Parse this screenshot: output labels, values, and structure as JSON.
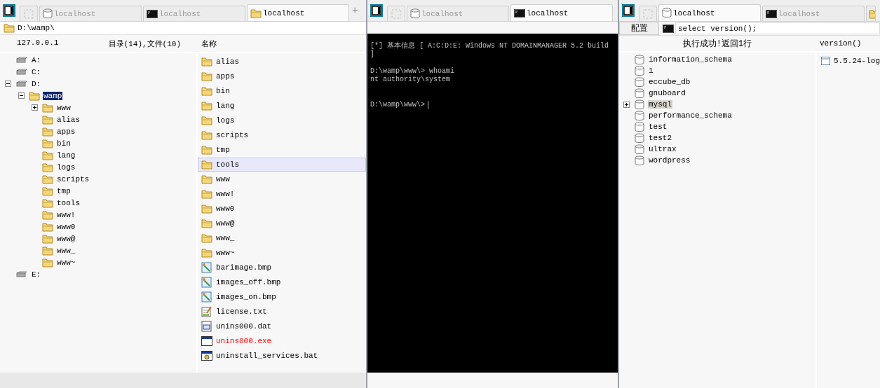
{
  "file_manager": {
    "tabs": [
      {
        "kind": "blank",
        "selected": false
      },
      {
        "kind": "database",
        "label": "localhost",
        "selected": false
      },
      {
        "kind": "terminal",
        "label": "localhost",
        "selected": false
      },
      {
        "kind": "folder",
        "label": "localhost",
        "selected": true
      }
    ],
    "add_tab": "+",
    "path": "D:\\wamp\\",
    "host": "127.0.0.1",
    "summary": "目录(14),文件(10)",
    "name_column": "名称",
    "tree": [
      {
        "kind": "drive",
        "label": "A:",
        "selected": false
      },
      {
        "kind": "drive",
        "label": "C:",
        "selected": false
      },
      {
        "kind": "drive",
        "label": "D:",
        "expanded": true,
        "selected": false,
        "children": [
          {
            "kind": "folder",
            "label": "wamp",
            "expanded": true,
            "selected": true,
            "children": [
              {
                "kind": "folder",
                "label": "www",
                "expanded": false,
                "selected": false
              },
              {
                "kind": "folder",
                "label": "alias",
                "selected": false
              },
              {
                "kind": "folder",
                "label": "apps",
                "selected": false
              },
              {
                "kind": "folder",
                "label": "bin",
                "selected": false
              },
              {
                "kind": "folder",
                "label": "lang",
                "selected": false
              },
              {
                "kind": "folder",
                "label": "logs",
                "selected": false
              },
              {
                "kind": "folder",
                "label": "scripts",
                "selected": false
              },
              {
                "kind": "folder",
                "label": "tmp",
                "selected": false
              },
              {
                "kind": "folder",
                "label": "tools",
                "selected": false
              },
              {
                "kind": "folder",
                "label": "www!",
                "selected": false
              },
              {
                "kind": "folder",
                "label": "www0",
                "selected": false
              },
              {
                "kind": "folder",
                "label": "www@",
                "selected": false
              },
              {
                "kind": "folder",
                "label": "www_",
                "selected": false
              },
              {
                "kind": "folder",
                "label": "www~",
                "selected": false
              }
            ]
          }
        ]
      },
      {
        "kind": "drive",
        "label": "E:",
        "selected": false
      }
    ],
    "files": [
      {
        "kind": "folder",
        "name": "alias",
        "selected": false
      },
      {
        "kind": "folder",
        "name": "apps",
        "selected": false
      },
      {
        "kind": "folder",
        "name": "bin",
        "selected": false
      },
      {
        "kind": "folder",
        "name": "lang",
        "selected": false
      },
      {
        "kind": "folder",
        "name": "logs",
        "selected": false
      },
      {
        "kind": "folder",
        "name": "scripts",
        "selected": false
      },
      {
        "kind": "folder",
        "name": "tmp",
        "selected": false
      },
      {
        "kind": "folder",
        "name": "tools",
        "selected": true
      },
      {
        "kind": "folder",
        "name": "www",
        "selected": false
      },
      {
        "kind": "folder",
        "name": "www!",
        "selected": false
      },
      {
        "kind": "folder",
        "name": "www0",
        "selected": false
      },
      {
        "kind": "folder",
        "name": "www@",
        "selected": false
      },
      {
        "kind": "folder",
        "name": "www_",
        "selected": false
      },
      {
        "kind": "folder",
        "name": "www~",
        "selected": false
      },
      {
        "kind": "image",
        "name": "barimage.bmp",
        "selected": false
      },
      {
        "kind": "image",
        "name": "images_off.bmp",
        "selected": false
      },
      {
        "kind": "image",
        "name": "images_on.bmp",
        "selected": false
      },
      {
        "kind": "text",
        "name": "license.txt",
        "selected": false
      },
      {
        "kind": "data",
        "name": "unins000.dat",
        "selected": false
      },
      {
        "kind": "program",
        "name": "unins000.exe",
        "selected": false,
        "color": "#ff0000"
      },
      {
        "kind": "script",
        "name": "uninstall_services.bat",
        "selected": false
      }
    ]
  },
  "terminal": {
    "tabs": [
      {
        "kind": "blank",
        "selected": false
      },
      {
        "kind": "database",
        "label": "localhost",
        "selected": false
      },
      {
        "kind": "terminal",
        "label": "localhost",
        "selected": true
      }
    ],
    "blocks": [
      [
        "[*] 基本信息 [ A:C:D:E: Windows NT DOMAINMANAGER 5.2 build",
        "]"
      ],
      [
        "D:\\wamp\\www\\> whoami",
        "nt authority\\system"
      ]
    ],
    "prompt": "D:\\wamp\\www\\>"
  },
  "database": {
    "tabs": [
      {
        "kind": "blank",
        "selected": false
      },
      {
        "kind": "database",
        "label": "localhost",
        "selected": true
      },
      {
        "kind": "terminal",
        "label": "localhost",
        "selected": false
      },
      {
        "kind": "folder",
        "selected": false
      }
    ],
    "config_button": "配置",
    "query": "select version();",
    "status": "执行成功!返回1行",
    "result_column": "version()",
    "databases": [
      {
        "name": "information_schema",
        "selected": false
      },
      {
        "name": "1",
        "selected": false
      },
      {
        "name": "eccube_db",
        "selected": false
      },
      {
        "name": "gnuboard",
        "selected": false
      },
      {
        "name": "mysql",
        "expanded": false,
        "selected": true
      },
      {
        "name": "performance_schema",
        "selected": false
      },
      {
        "name": "test",
        "selected": false
      },
      {
        "name": "test2",
        "selected": false
      },
      {
        "name": "ultrax",
        "selected": false
      },
      {
        "name": "wordpress",
        "selected": false
      }
    ],
    "result_rows": [
      "5.5.24-log"
    ]
  }
}
